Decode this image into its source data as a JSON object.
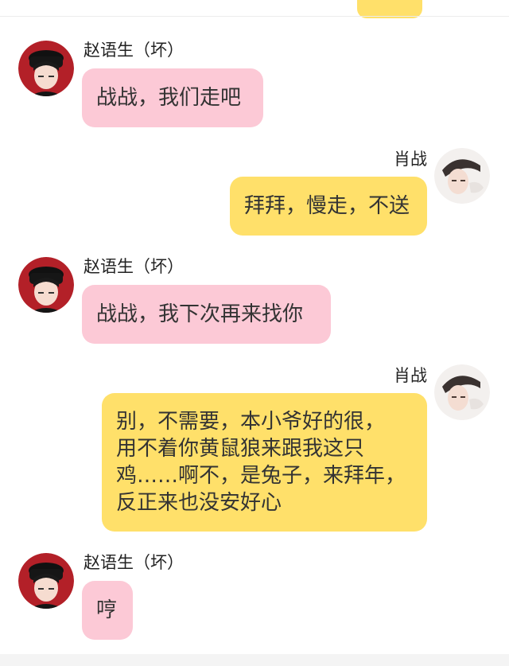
{
  "chat": {
    "messages": [
      {
        "sender": "赵语生（坏）",
        "side": "left",
        "text": "战战，我们走吧"
      },
      {
        "sender": "肖战",
        "side": "right",
        "text": "拜拜，慢走，不送"
      },
      {
        "sender": "赵语生（坏）",
        "side": "left",
        "text": "战战，我下次再来找你"
      },
      {
        "sender": "肖战",
        "side": "right",
        "text": "别，不需要，本小爷好的很，\n用不着你黄鼠狼来跟我这只\n鸡……啊不，是兔子，来拜年，\n反正来也没安好心"
      },
      {
        "sender": "赵语生（坏）",
        "side": "left",
        "text": "哼"
      }
    ]
  },
  "colors": {
    "left_bubble": "#fcc9d6",
    "right_bubble": "#ffe06a",
    "avatar_left_bg": "#b32028",
    "avatar_right_bg": "#f3f0ee"
  },
  "icons": {
    "left_avatar": "boy-in-black-hat-avatar",
    "right_avatar": "boy-portrait-avatar"
  }
}
